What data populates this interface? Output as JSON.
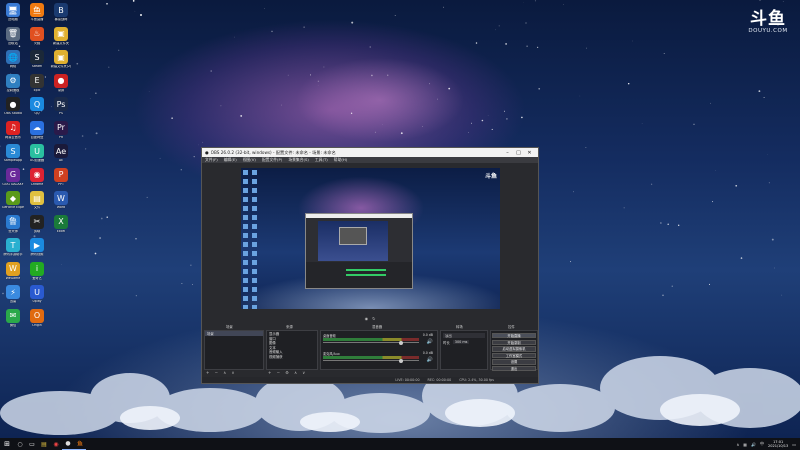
{
  "watermark": {
    "logo": "斗鱼",
    "url": "DOUYU.COM"
  },
  "desktop_icons": [
    {
      "label": "此电脑",
      "glyph": "🖥",
      "color": "#3a7bd5"
    },
    {
      "label": "回收站",
      "glyph": "🗑",
      "color": "#5a6a80"
    },
    {
      "label": "网络",
      "glyph": "🌐",
      "color": "#2f6fb5"
    },
    {
      "label": "控制面板",
      "glyph": "⚙",
      "color": "#2f7fc0"
    },
    {
      "label": "OBS Studio",
      "glyph": "●",
      "color": "#222"
    },
    {
      "label": "网易云音乐",
      "glyph": "♫",
      "color": "#d22"
    },
    {
      "label": "SampleApp",
      "glyph": "S",
      "color": "#2a8ad6"
    },
    {
      "label": "GOG GALAXY",
      "glyph": "G",
      "color": "#6a2a9a"
    },
    {
      "label": "GeForce Experience",
      "glyph": "◆",
      "color": "#5a9a1a"
    },
    {
      "label": "鲁大师",
      "glyph": "鲁",
      "color": "#2a7ad0"
    },
    {
      "label": "腾讯手游助手",
      "glyph": "T",
      "color": "#2ab0d0"
    },
    {
      "label": "WeGame",
      "glyph": "W",
      "color": "#e0a020"
    },
    {
      "label": "迅雷",
      "glyph": "⚡",
      "color": "#3a8ae0"
    },
    {
      "label": "微信",
      "glyph": "✉",
      "color": "#2aa84a"
    },
    {
      "label": "斗鱼直播",
      "glyph": "鱼",
      "color": "#f07a10"
    },
    {
      "label": "火绒",
      "glyph": "♨",
      "color": "#e05020"
    },
    {
      "label": "Steam",
      "glyph": "S",
      "color": "#1b2838"
    },
    {
      "label": "Epic",
      "glyph": "E",
      "color": "#333"
    },
    {
      "label": "QQ",
      "glyph": "Q",
      "color": "#1a8ae0"
    },
    {
      "label": "百度网盘",
      "glyph": "☁",
      "color": "#2a70e0"
    },
    {
      "label": "UU加速器",
      "glyph": "U",
      "color": "#2ac0a0"
    },
    {
      "label": "Chrome",
      "glyph": "◉",
      "color": "#d23"
    },
    {
      "label": "文件",
      "glyph": "▤",
      "color": "#e0c040"
    },
    {
      "label": "剪映",
      "glyph": "✂",
      "color": "#222"
    },
    {
      "label": "腾讯视频",
      "glyph": "▶",
      "color": "#1a8ae0"
    },
    {
      "label": "爱奇艺",
      "glyph": "i",
      "color": "#2a2"
    },
    {
      "label": "Uplay",
      "glyph": "U",
      "color": "#2a5ad0"
    },
    {
      "label": "Origin",
      "glyph": "O",
      "color": "#e06a10"
    },
    {
      "label": "暴雪战网",
      "glyph": "B",
      "color": "#1a3a70"
    },
    {
      "label": "新建文件夹",
      "glyph": "▣",
      "color": "#e0b030"
    },
    {
      "label": "新建文件夹(2)",
      "glyph": "▣",
      "color": "#e0b030"
    },
    {
      "label": "录屏",
      "glyph": "●",
      "color": "#c22"
    },
    {
      "label": "PS",
      "glyph": "Ps",
      "color": "#1a2a4a"
    },
    {
      "label": "PR",
      "glyph": "Pr",
      "color": "#2a1a4a"
    },
    {
      "label": "AE",
      "glyph": "Ae",
      "color": "#1a1a3a"
    },
    {
      "label": "PPT",
      "glyph": "P",
      "color": "#d04020"
    },
    {
      "label": "Word",
      "glyph": "W",
      "color": "#2a5ab0"
    },
    {
      "label": "Excel",
      "glyph": "X",
      "color": "#1a7a3a"
    }
  ],
  "obs": {
    "title": "OBS 26.0.2 (32-bit, windows) - 配置文件: 未命名 - 场景: 未命名",
    "menu": [
      "文件(F)",
      "编辑(E)",
      "视图(V)",
      "配置文件(P)",
      "场景集合(S)",
      "工具(T)",
      "帮助(H)"
    ],
    "preview_logo": "斗鱼",
    "docks": {
      "scenes_header": "场景",
      "sources_header": "来源",
      "mixer_header": "混音器",
      "transitions_header": "转场",
      "controls_header": "控件"
    },
    "scenes": [
      "场景"
    ],
    "sources": [
      "显示器",
      "窗口",
      "图像",
      "文本",
      "音频输入",
      "视频捕获"
    ],
    "mixer": [
      {
        "name": "桌面音频",
        "db": "0.0 dB"
      },
      {
        "name": "麦克风/Aux",
        "db": "0.0 dB"
      }
    ],
    "transition": {
      "type": "淡出",
      "duration_label": "时长",
      "duration": "300 ms"
    },
    "controls": [
      "开始直播",
      "开始录制",
      "启动虚拟摄像机",
      "工作室模式",
      "设置",
      "退出"
    ],
    "status": [
      "LIVE: 00:00:00",
      "REC: 00:00:00",
      "CPU: 2.4%, 30.00 fps"
    ]
  },
  "taskbar": {
    "apps": [
      {
        "name": "start",
        "glyph": "⊞"
      },
      {
        "name": "search",
        "glyph": "○"
      },
      {
        "name": "task-view",
        "glyph": "▭"
      },
      {
        "name": "explorer",
        "glyph": "▤"
      },
      {
        "name": "chrome",
        "glyph": "◉"
      },
      {
        "name": "obs",
        "glyph": "●"
      },
      {
        "name": "douyu",
        "glyph": "鱼"
      }
    ],
    "time": "17:01",
    "date": "2021/10/13"
  }
}
